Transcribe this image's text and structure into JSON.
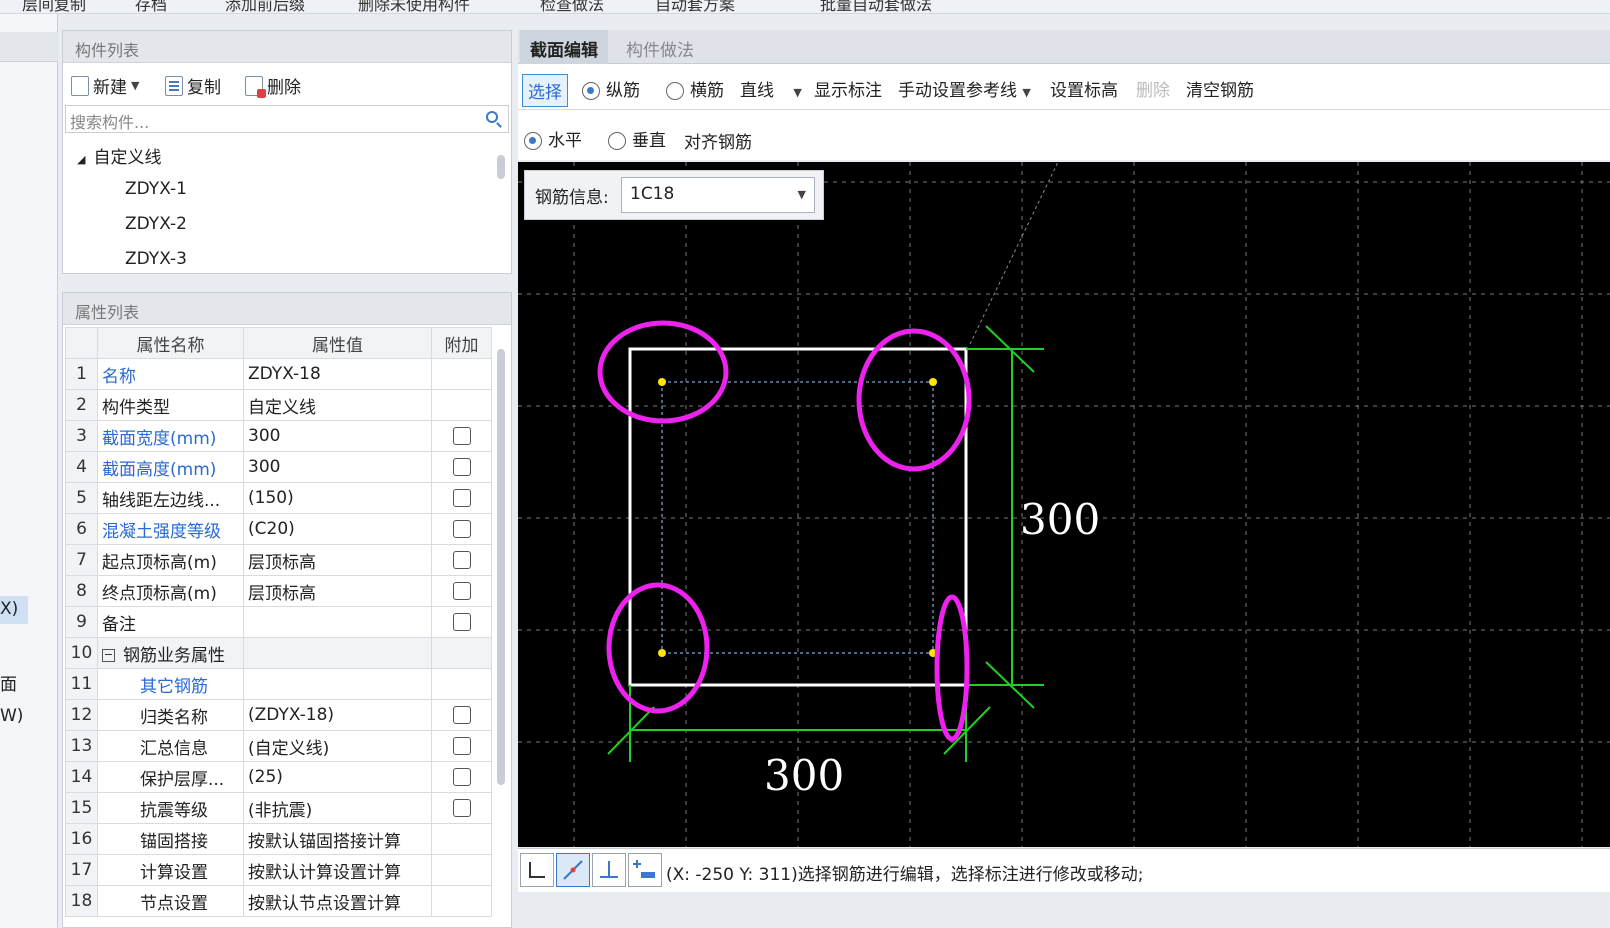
{
  "top_strip": [
    "层间复制",
    "存档",
    "添加前后缀",
    "删除未使用构件",
    "检查做法",
    "自动套方案",
    "批量自动套做法"
  ],
  "left_edge": {
    "frag_x": "X)",
    "frag_mian": "面",
    "frag_w": "W)"
  },
  "component_list": {
    "title": "构件列表",
    "new_label": "新建",
    "copy_label": "复制",
    "delete_label": "删除",
    "search_placeholder": "搜索构件...",
    "tree_root": "自定义线",
    "items": [
      "ZDYX-1",
      "ZDYX-2",
      "ZDYX-3"
    ]
  },
  "property_list": {
    "title": "属性列表",
    "headers": {
      "name": "属性名称",
      "value": "属性值",
      "extra": "附加"
    },
    "rows": [
      {
        "n": "1",
        "name": "名称",
        "value": "ZDYX-18"
      },
      {
        "n": "2",
        "name": "构件类型",
        "value": "自定义线"
      },
      {
        "n": "3",
        "name": "截面宽度(mm)",
        "value": "300"
      },
      {
        "n": "4",
        "name": "截面高度(mm)",
        "value": "300"
      },
      {
        "n": "5",
        "name": "轴线距左边线...",
        "value": "(150)"
      },
      {
        "n": "6",
        "name": "混凝土强度等级",
        "value": "(C20)"
      },
      {
        "n": "7",
        "name": "起点顶标高(m)",
        "value": "层顶标高"
      },
      {
        "n": "8",
        "name": "终点顶标高(m)",
        "value": "层顶标高"
      },
      {
        "n": "9",
        "name": "备注",
        "value": ""
      },
      {
        "n": "10",
        "name": "钢筋业务属性",
        "value": ""
      },
      {
        "n": "11",
        "name": "其它钢筋",
        "value": ""
      },
      {
        "n": "12",
        "name": "归类名称",
        "value": "(ZDYX-18)"
      },
      {
        "n": "13",
        "name": "汇总信息",
        "value": "(自定义线)"
      },
      {
        "n": "14",
        "name": "保护层厚...",
        "value": "(25)"
      },
      {
        "n": "15",
        "name": "抗震等级",
        "value": "(非抗震)"
      },
      {
        "n": "16",
        "name": "锚固搭接",
        "value": "按默认锚固搭接计算"
      },
      {
        "n": "17",
        "name": "计算设置",
        "value": "按默认计算设置计算"
      },
      {
        "n": "18",
        "name": "节点设置",
        "value": "按默认节点设置计算"
      }
    ]
  },
  "tabs": {
    "section_edit": "截面编辑",
    "component_method": "构件做法"
  },
  "toolbar1": {
    "select": "选择",
    "longitudinal": "纵筋",
    "transverse": "横筋",
    "line": "直线",
    "show_dim": "显示标注",
    "manual_ref": "手动设置参考线",
    "set_elev": "设置标高",
    "delete": "删除",
    "clear": "清空钢筋"
  },
  "toolbar2": {
    "horizontal": "水平",
    "vertical": "垂直",
    "align": "对齐钢筋"
  },
  "rebar_info": {
    "label": "钢筋信息:",
    "value": "1C18"
  },
  "drawing": {
    "dim_right": "300",
    "dim_bottom": "300"
  },
  "status": {
    "text": "(X: -250 Y: 311)选择钢筋进行编辑，选择标注进行修改或移动;"
  }
}
